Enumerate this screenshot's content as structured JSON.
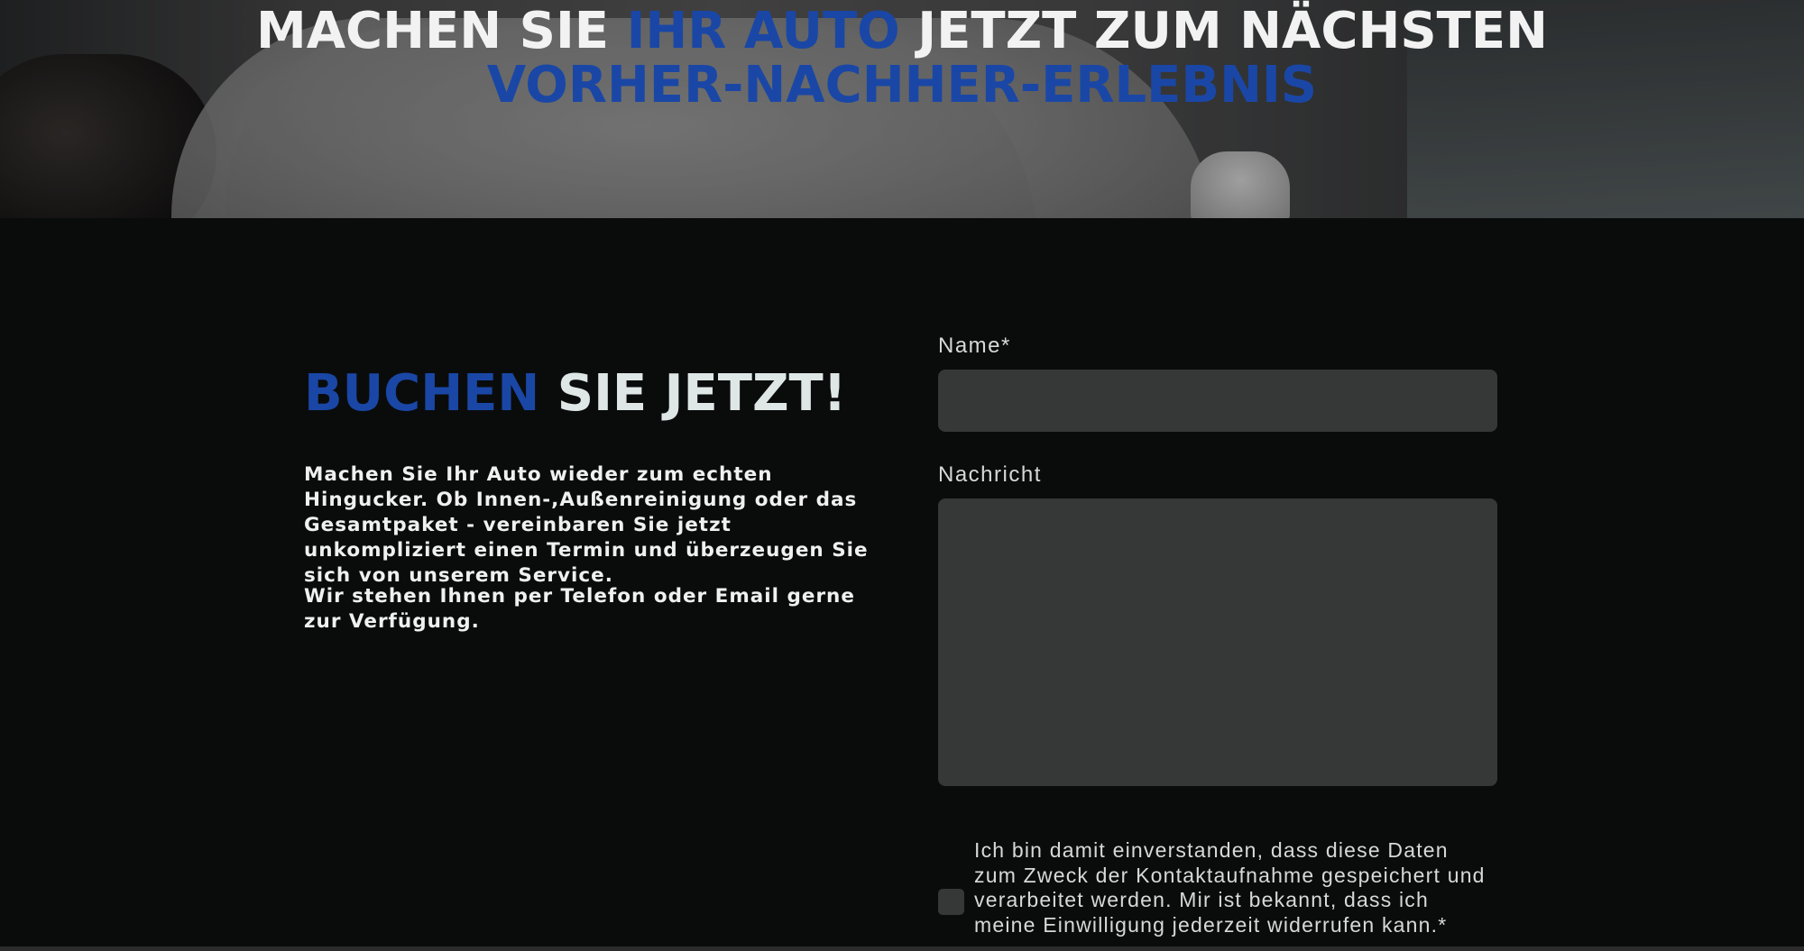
{
  "hero": {
    "title_part1": "MACHEN SIE ",
    "title_highlight": "IHR AUTO",
    "title_part2": " JETZT ZUM NÄCHSTEN",
    "title_line2": "VORHER-NACHHER-ERLEBNIS"
  },
  "booking": {
    "heading_highlight": "BUCHEN",
    "heading_rest": " SIE JETZT!",
    "paragraph1": "Machen Sie Ihr Auto wieder zum echten Hingucker. Ob Innen-,Außenreinigung oder das Gesamtpaket - vereinbaren Sie jetzt unkompliziert einen Termin und überzeugen Sie sich von unserem Service.",
    "paragraph2": "Wir stehen Ihnen  per Telefon oder Email gerne zur Verfügung."
  },
  "form": {
    "name_label": "Name*",
    "name_value": "",
    "message_label": "Nachricht",
    "message_value": "",
    "consent_text": "Ich bin damit einverstanden, dass diese Daten zum Zweck der Kontaktaufnahme gespeichert und verarbeitet werden. Mir ist bekannt, dass ich meine Einwilligung jederzeit widerrufen kann.*",
    "consent_checked": false
  },
  "colors": {
    "accent": "#1a47a6",
    "background": "#0a0c0c",
    "field": "#363837"
  }
}
